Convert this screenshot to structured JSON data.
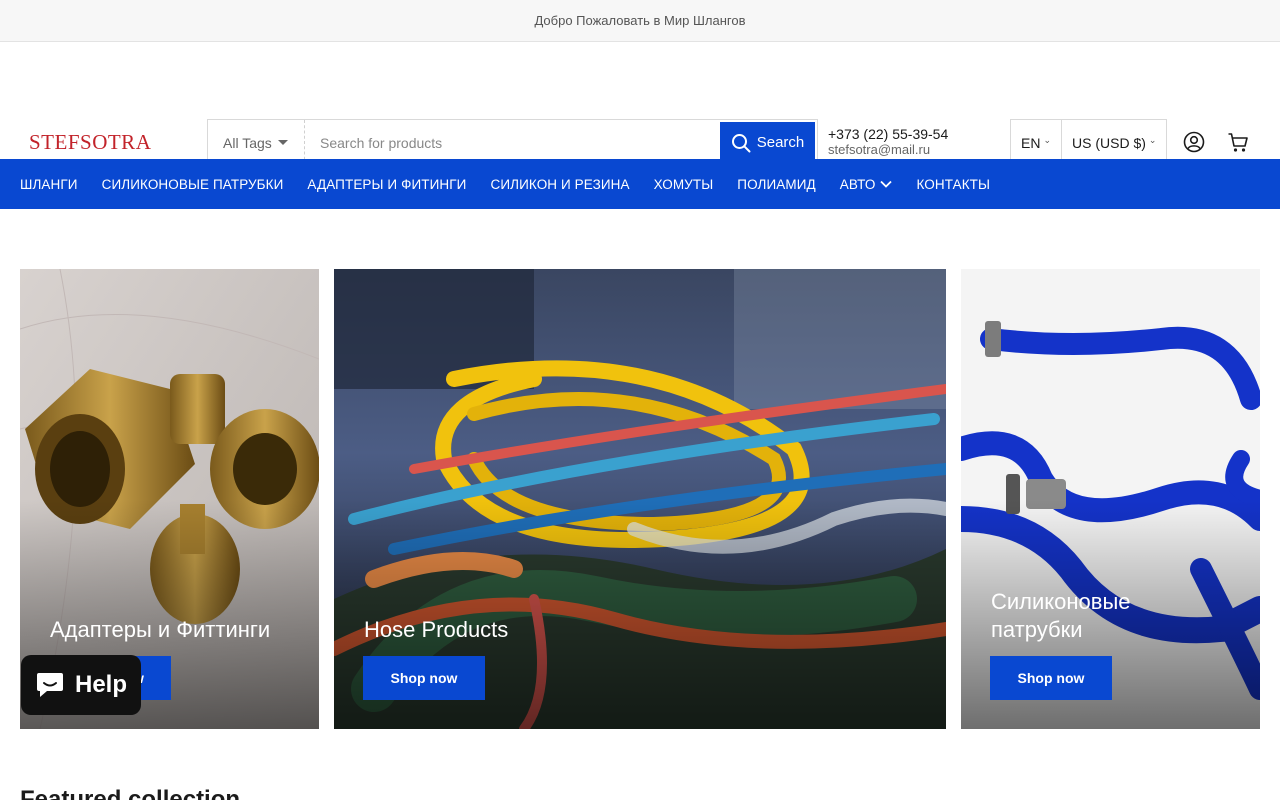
{
  "announcement": "Добро Пожаловать в Мир Шлангов",
  "header": {
    "logo": "STEFSOTRA",
    "search": {
      "tags_label": "All Tags",
      "placeholder": "Search for products",
      "button_label": "Search"
    },
    "contact": {
      "phone": "+373 (22) 55-39-54",
      "email": "stefsotra@mail.ru"
    },
    "language": "EN",
    "currency": "US (USD $)",
    "icons": [
      "account-icon",
      "cart-icon"
    ]
  },
  "nav": {
    "items": [
      {
        "label": "ШЛАНГИ"
      },
      {
        "label": "СИЛИКОНОВЫЕ ПАТРУБКИ"
      },
      {
        "label": "АДАПТЕРЫ И ФИТИНГИ"
      },
      {
        "label": "СИЛИКОН И РЕЗИНА"
      },
      {
        "label": "ХОМУТЫ"
      },
      {
        "label": "ПОЛИАМИД"
      },
      {
        "label": "АВТО",
        "has_dropdown": true
      },
      {
        "label": "КОНТАКТЫ"
      }
    ]
  },
  "banners": [
    {
      "title": "Адаптеры и Фиттинги",
      "button": "Shop now"
    },
    {
      "title": "Hose Products",
      "button": "Shop now"
    },
    {
      "title": "Силиконовые патрубки",
      "button": "Shop now"
    }
  ],
  "chat_widget": {
    "label": "Help"
  },
  "featured": {
    "title": "Featured collection"
  },
  "colors": {
    "accent": "#0948d1",
    "logo": "#c2232a"
  }
}
